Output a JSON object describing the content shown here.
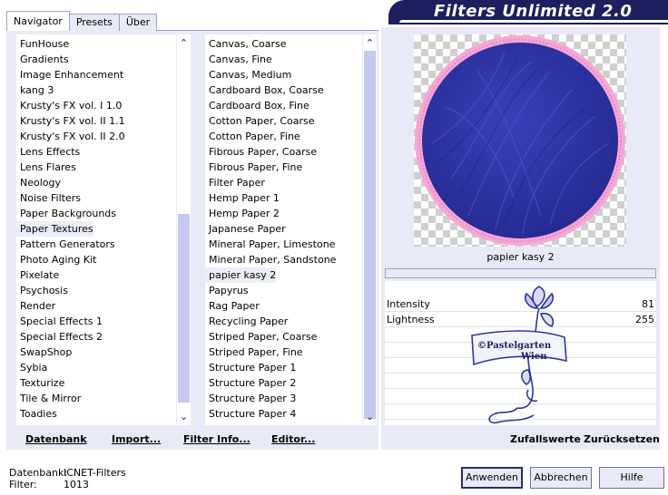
{
  "tabs": [
    {
      "label": "Navigator"
    },
    {
      "label": "Presets"
    },
    {
      "label": "Über"
    }
  ],
  "app_title": "Filters Unlimited 2.0",
  "categories": [
    {
      "label": "FunHouse"
    },
    {
      "label": "Gradients"
    },
    {
      "label": "Image Enhancement"
    },
    {
      "label": "kang 3"
    },
    {
      "label": "Krusty's FX vol. I 1.0"
    },
    {
      "label": "Krusty's FX vol. II 1.1"
    },
    {
      "label": "Krusty's FX vol. II 2.0"
    },
    {
      "label": "Lens Effects"
    },
    {
      "label": "Lens Flares"
    },
    {
      "label": "Neology"
    },
    {
      "label": "Noise Filters"
    },
    {
      "label": "Paper Backgrounds"
    },
    {
      "label": "Paper Textures"
    },
    {
      "label": "Pattern Generators"
    },
    {
      "label": "Photo Aging Kit"
    },
    {
      "label": "Pixelate"
    },
    {
      "label": "Psychosis"
    },
    {
      "label": "Render"
    },
    {
      "label": "Special Effects 1"
    },
    {
      "label": "Special Effects 2"
    },
    {
      "label": "SwapShop"
    },
    {
      "label": "Sybia"
    },
    {
      "label": "Texturize"
    },
    {
      "label": "Tile & Mirror"
    },
    {
      "label": "Toadies"
    }
  ],
  "selected_category": "Paper Textures",
  "filters": [
    {
      "label": "Canvas, Coarse"
    },
    {
      "label": "Canvas, Fine"
    },
    {
      "label": "Canvas, Medium"
    },
    {
      "label": "Cardboard Box, Coarse"
    },
    {
      "label": "Cardboard Box, Fine"
    },
    {
      "label": "Cotton Paper, Coarse"
    },
    {
      "label": "Cotton Paper, Fine"
    },
    {
      "label": "Fibrous Paper, Coarse"
    },
    {
      "label": "Fibrous Paper, Fine"
    },
    {
      "label": "Filter Paper"
    },
    {
      "label": "Hemp Paper 1"
    },
    {
      "label": "Hemp Paper 2"
    },
    {
      "label": "Japanese Paper"
    },
    {
      "label": "Mineral Paper, Limestone"
    },
    {
      "label": "Mineral Paper, Sandstone"
    },
    {
      "label": "papier kasy 2"
    },
    {
      "label": "Papyrus"
    },
    {
      "label": "Rag Paper"
    },
    {
      "label": "Recycling Paper"
    },
    {
      "label": "Striped Paper, Coarse"
    },
    {
      "label": "Striped Paper, Fine"
    },
    {
      "label": "Structure Paper 1"
    },
    {
      "label": "Structure Paper 2"
    },
    {
      "label": "Structure Paper 3"
    },
    {
      "label": "Structure Paper 4"
    }
  ],
  "selected_filter": "papier kasy 2",
  "preview_filter_name": "papier kasy 2",
  "parameters": [
    {
      "label": "Intensity",
      "value": "81"
    },
    {
      "label": "Lightness",
      "value": "255"
    }
  ],
  "watermark": "©Pastelgarten Wien",
  "nav_links": {
    "datenbank": "Datenbank",
    "import": "Import...",
    "filter_info": "Filter Info...",
    "editor": "Editor..."
  },
  "preview_links": {
    "random": "Zufallswerte",
    "reset": "Zurücksetzen"
  },
  "status": {
    "db_label": "Datenbank:",
    "db_value": "ICNET-Filters",
    "filter_label": "Filter:",
    "filter_value": "1013"
  },
  "buttons": {
    "apply": "Anwenden",
    "cancel": "Abbrechen",
    "help": "Hilfe"
  },
  "colors": {
    "panel": "#e8eaf7",
    "banner": "#1d1f5e",
    "preview_fill": "#2f34a6",
    "preview_ring": "#f5a8d8",
    "selection": "#eceef9",
    "scroll_thumb": "#c5c8ee"
  }
}
